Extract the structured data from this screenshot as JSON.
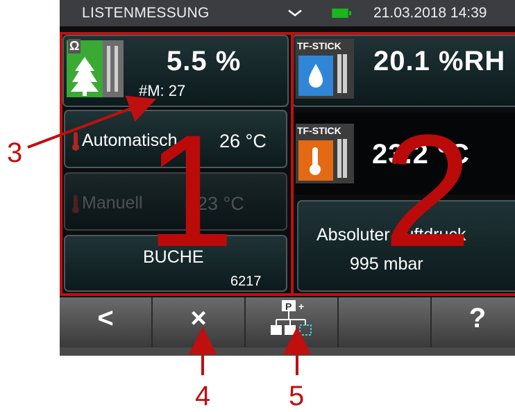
{
  "statusbar": {
    "title": "LISTENMESSUNG",
    "datetime": "21.03.2018 14:39",
    "dropdown_icon": "chevron-down-icon",
    "battery_icon": "battery-icon",
    "battery_color": "#19b81c"
  },
  "left_panel": {
    "sensor_label": "Ω",
    "value": "5.5 %",
    "measurement_number": "#M: 27",
    "auto_temp": {
      "label": "Automatisch",
      "value": "26 °C"
    },
    "manual_temp": {
      "label": "Manuell",
      "value": "23 °C"
    },
    "material": {
      "name": "BUCHE",
      "code": "6217"
    }
  },
  "right_panel": {
    "humidity": {
      "sensor_label": "TF-STICK",
      "value": "20.1 %RH"
    },
    "temperature": {
      "sensor_label": "TF-STICK",
      "value": "23.2 °C"
    },
    "pressure": {
      "label": "Absoluter Luftdruck",
      "value": "995 mbar"
    }
  },
  "navbar": {
    "back": "<",
    "close": "×",
    "help": "?",
    "program_icon": "program-tree-icon",
    "program_label": "P"
  },
  "annotations": {
    "area1": "1",
    "area2": "2",
    "callout3": "3",
    "callout4": "4",
    "callout5": "5"
  },
  "colors": {
    "annotation_red": "#c00f0f",
    "sensor_green": "#3aaa35",
    "sensor_blue": "#2f86d6",
    "sensor_orange": "#e36a13"
  }
}
